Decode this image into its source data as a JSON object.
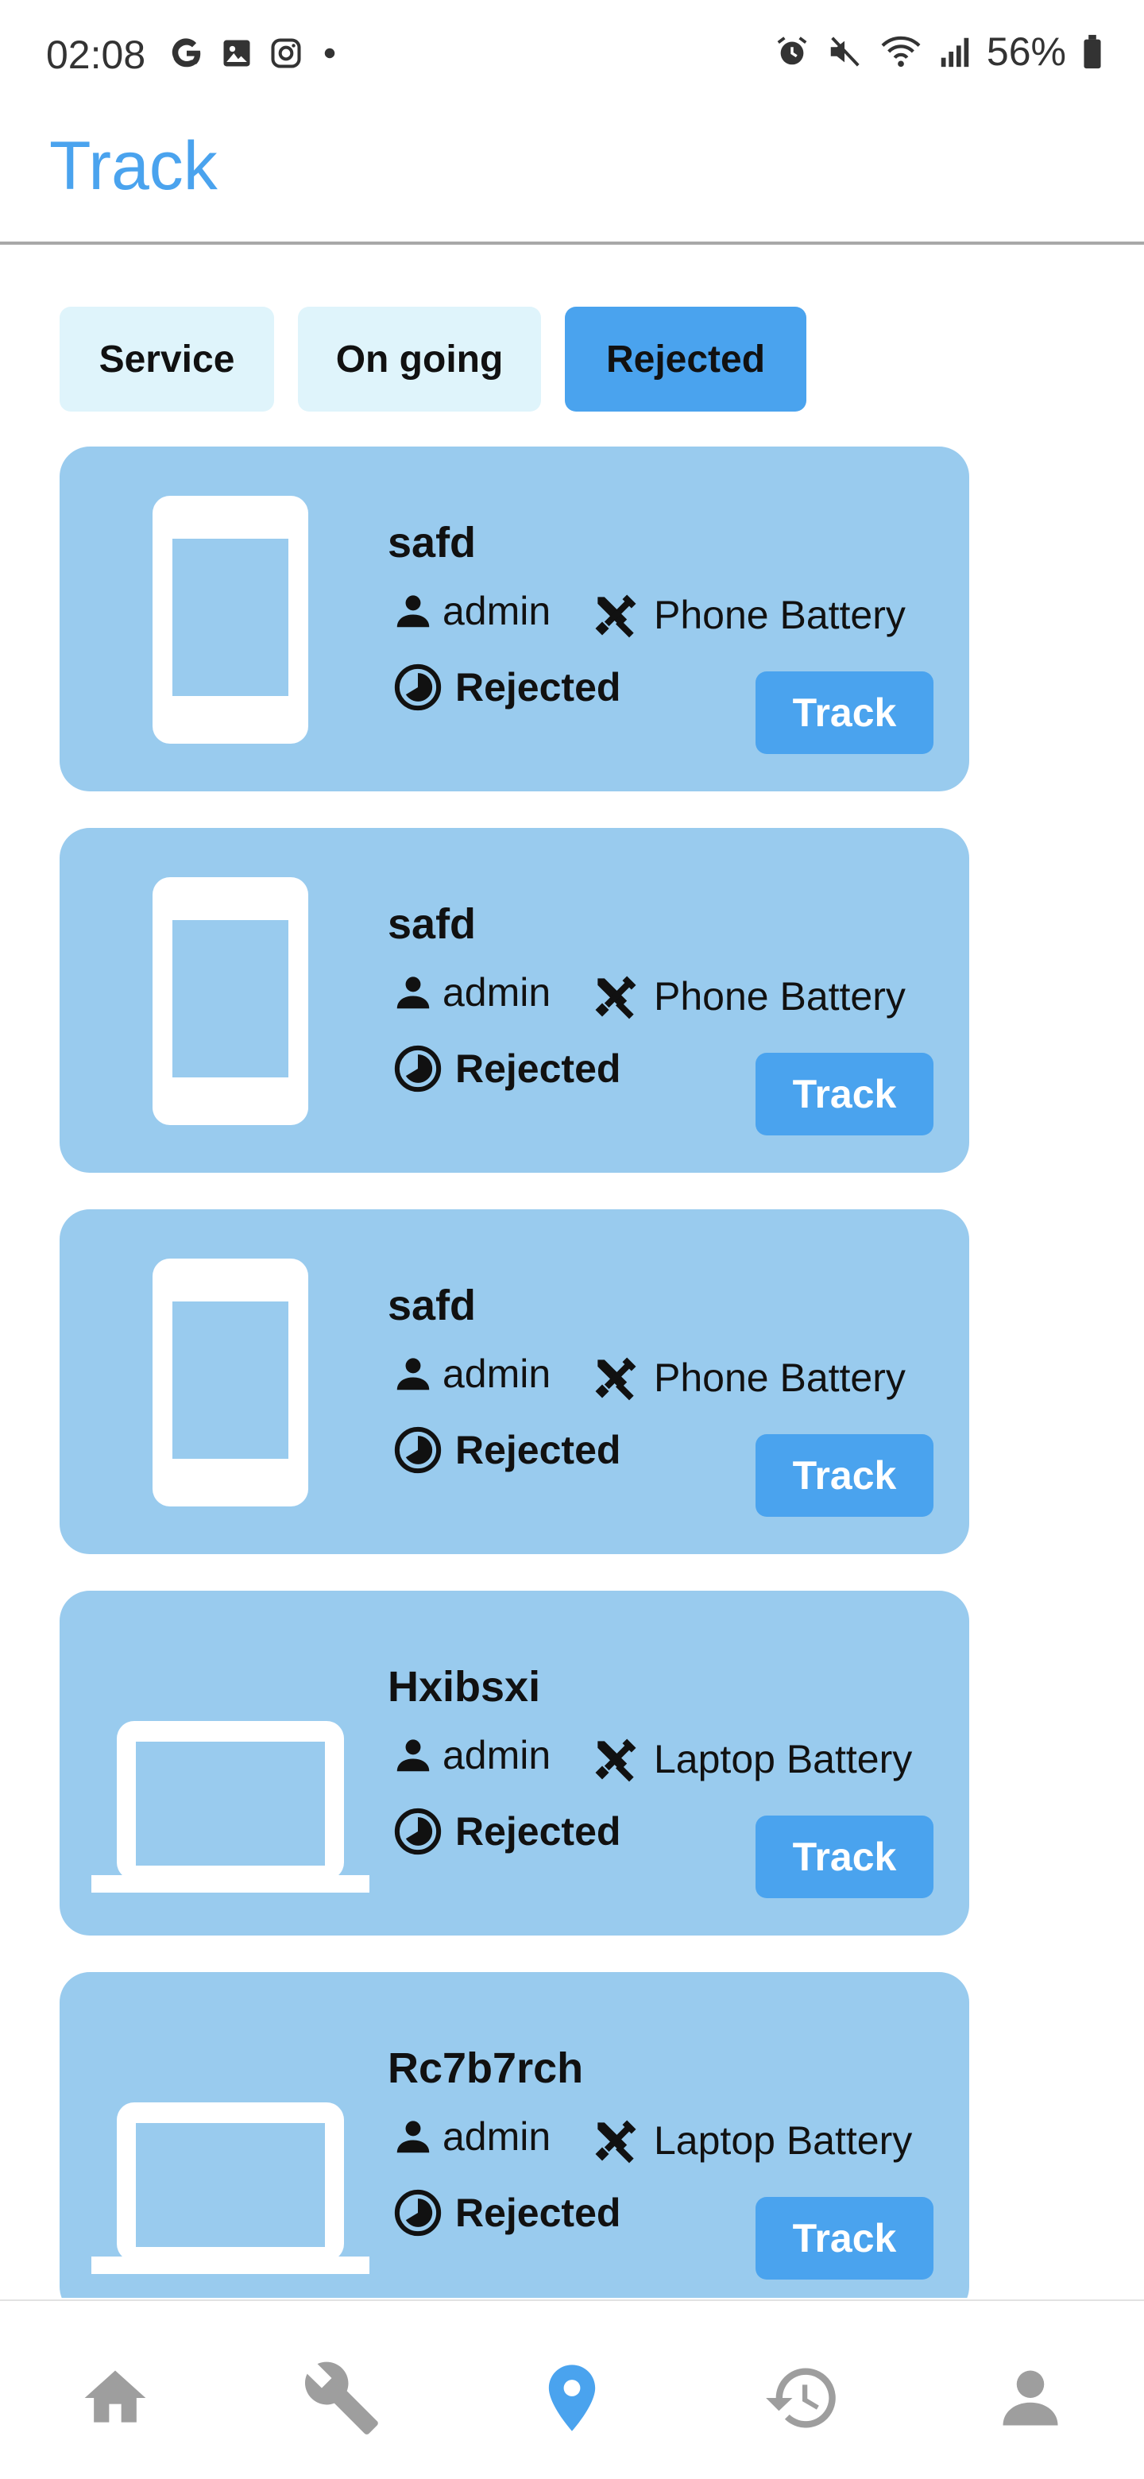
{
  "status_bar": {
    "time": "02:08",
    "battery": "56%",
    "left_icons": [
      "google-icon",
      "image-icon",
      "instagram-icon",
      "dot-icon"
    ],
    "right_icons": [
      "alarm-icon",
      "mute-icon",
      "wifi-icon",
      "signal-icon",
      "battery-icon"
    ]
  },
  "app_bar": {
    "title": "Track"
  },
  "filters": {
    "items": [
      {
        "label": "Service",
        "active": false
      },
      {
        "label": "On going",
        "active": false
      },
      {
        "label": "Rejected",
        "active": true
      }
    ]
  },
  "cards": [
    {
      "title": "safd",
      "device": "phone",
      "user": "admin",
      "service": "Phone Battery",
      "status": "Rejected",
      "button": "Track"
    },
    {
      "title": "safd",
      "device": "phone",
      "user": "admin",
      "service": "Phone Battery",
      "status": "Rejected",
      "button": "Track"
    },
    {
      "title": "safd",
      "device": "phone",
      "user": "admin",
      "service": "Phone Battery",
      "status": "Rejected",
      "button": "Track"
    },
    {
      "title": "Hxibsxi",
      "device": "laptop",
      "user": "admin",
      "service": "Laptop Battery",
      "status": "Rejected",
      "button": "Track"
    },
    {
      "title": "Rc7b7rch",
      "device": "laptop",
      "user": "admin",
      "service": "Laptop Battery",
      "status": "Rejected",
      "button": "Track"
    }
  ],
  "bottom_nav": {
    "items": [
      {
        "icon": "home-icon",
        "active": false
      },
      {
        "icon": "wrench-icon",
        "active": false
      },
      {
        "icon": "location-pin-icon",
        "active": true
      },
      {
        "icon": "history-icon",
        "active": false
      },
      {
        "icon": "profile-icon",
        "active": false
      }
    ]
  },
  "colors": {
    "accent": "#4aa3ee",
    "card_bg": "#99cbee",
    "chip_bg": "#dff4fb",
    "nav_inactive": "#9e9e9e"
  }
}
